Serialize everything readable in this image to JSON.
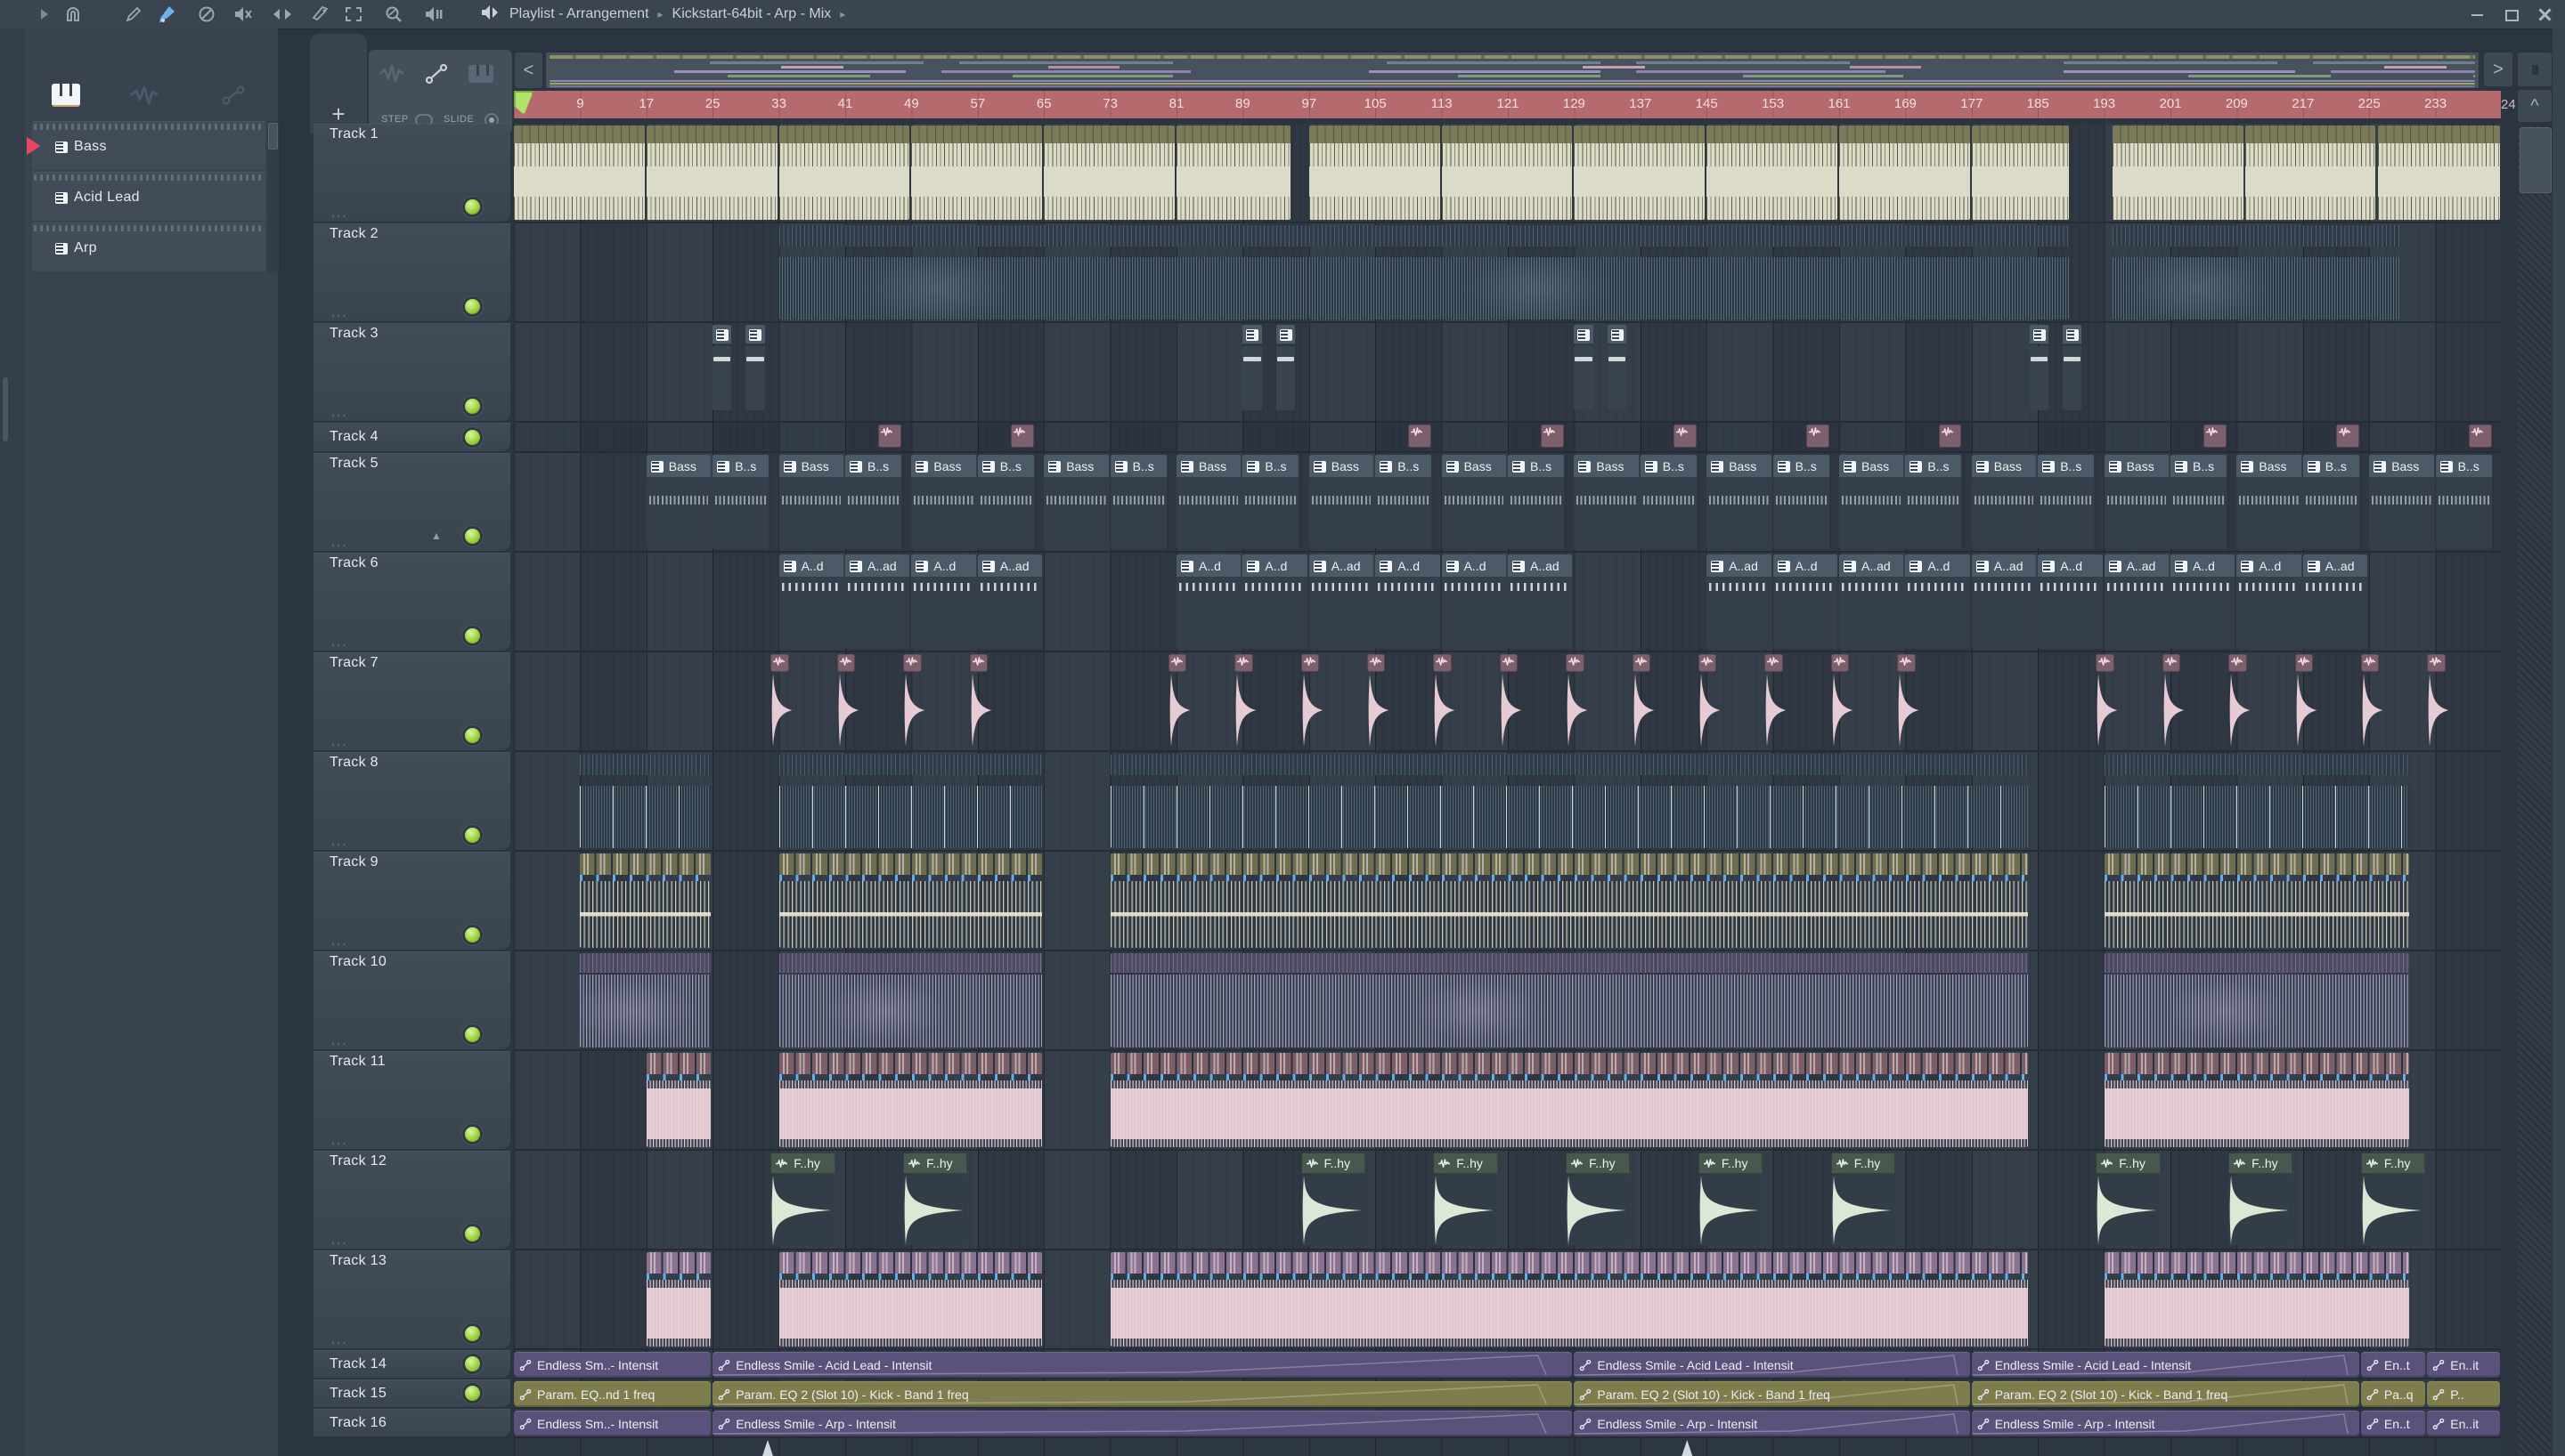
{
  "window": {
    "breadcrumb": [
      "Playlist - Arrangement",
      "Kickstart-64bit - Arp - Mix"
    ],
    "controls": [
      "minimize",
      "maximize",
      "close"
    ]
  },
  "toolbar": {
    "icons": [
      "play-arrow",
      "magnet",
      "pencil",
      "paint-brush",
      "no-entry",
      "mute",
      "slip",
      "slice",
      "select",
      "zoom",
      "preview-speaker"
    ],
    "active_icon": "paint-brush"
  },
  "picker": {
    "tabs": [
      "piano",
      "waveform",
      "automation"
    ],
    "selected_tab": "piano",
    "patterns": [
      {
        "name": "Bass",
        "selected": true
      },
      {
        "name": "Acid Lead",
        "selected": false
      },
      {
        "name": "Arp",
        "selected": false
      }
    ]
  },
  "playlist": {
    "buttons": {
      "add": "+",
      "scroll_left": "<",
      "scroll_right": ">",
      "up": "^"
    },
    "tools": {
      "step_label": "STEP",
      "slide_label": "SLIDE",
      "step_on": false,
      "slide_on": true
    },
    "ruler": {
      "labels": [
        9,
        17,
        25,
        33,
        41,
        49,
        57,
        65,
        73,
        81,
        89,
        97,
        105,
        113,
        121,
        129,
        137,
        145,
        153,
        161,
        169,
        177,
        185,
        193,
        201,
        209,
        217,
        225,
        233
      ],
      "overflow_label": "24",
      "playhead_bar": 1
    },
    "tracks": [
      {
        "name": "Track 1",
        "h": "n",
        "kind": "cream",
        "clips": [
          {
            "s": 1,
            "l": 16
          },
          {
            "s": 17,
            "l": 16
          },
          {
            "s": 33,
            "l": 16
          },
          {
            "s": 49,
            "l": 16
          },
          {
            "s": 65,
            "l": 16
          },
          {
            "s": 81,
            "l": 14
          },
          {
            "s": 97,
            "l": 16
          },
          {
            "s": 113,
            "l": 16
          },
          {
            "s": 129,
            "l": 16
          },
          {
            "s": 145,
            "l": 16
          },
          {
            "s": 161,
            "l": 16
          },
          {
            "s": 177,
            "l": 12
          },
          {
            "s": 194,
            "l": 16
          },
          {
            "s": 210,
            "l": 16
          },
          {
            "s": 226,
            "l": 15
          }
        ]
      },
      {
        "name": "Track 2",
        "h": "n",
        "kind": "teal",
        "clips": [
          {
            "s": 33,
            "l": 64
          },
          {
            "s": 97,
            "l": 92
          },
          {
            "s": 194,
            "l": 35
          }
        ]
      },
      {
        "name": "Track 3",
        "h": "n",
        "kind": "pat3",
        "clips": [
          {
            "s": 25,
            "l": 2.5
          },
          {
            "s": 29,
            "l": 2.5
          },
          {
            "s": 89,
            "l": 2.5
          },
          {
            "s": 93,
            "l": 2.5
          },
          {
            "s": 129,
            "l": 2.5
          },
          {
            "s": 133,
            "l": 2.5
          },
          {
            "s": 184,
            "l": 2.5
          },
          {
            "s": 188,
            "l": 2.5
          }
        ]
      },
      {
        "name": "Track 4",
        "h": "s",
        "kind": "kick",
        "clips": [
          {
            "s": 45,
            "l": 3
          },
          {
            "s": 61,
            "l": 3
          },
          {
            "s": 109,
            "l": 3
          },
          {
            "s": 125,
            "l": 3
          },
          {
            "s": 141,
            "l": 3
          },
          {
            "s": 157,
            "l": 3
          },
          {
            "s": 173,
            "l": 3
          },
          {
            "s": 205,
            "l": 3
          },
          {
            "s": 221,
            "l": 3
          },
          {
            "s": 237,
            "l": 3
          }
        ]
      },
      {
        "name": "Track 5",
        "h": "n",
        "kind": "patB",
        "collapse": true,
        "clips": [
          {
            "s": 17,
            "l": 8,
            "t": "Bass"
          },
          {
            "s": 25,
            "l": 7,
            "t": "B..s"
          },
          {
            "s": 33,
            "l": 8,
            "t": "Bass"
          },
          {
            "s": 41,
            "l": 7,
            "t": "B..s"
          },
          {
            "s": 49,
            "l": 8,
            "t": "Bass"
          },
          {
            "s": 57,
            "l": 7,
            "t": "B..s"
          },
          {
            "s": 65,
            "l": 8,
            "t": "Bass"
          },
          {
            "s": 73,
            "l": 7,
            "t": "B..s"
          },
          {
            "s": 81,
            "l": 8,
            "t": "Bass"
          },
          {
            "s": 89,
            "l": 7,
            "t": "B..s"
          },
          {
            "s": 97,
            "l": 8,
            "t": "Bass"
          },
          {
            "s": 105,
            "l": 7,
            "t": "B..s"
          },
          {
            "s": 113,
            "l": 8,
            "t": "Bass"
          },
          {
            "s": 121,
            "l": 7,
            "t": "B..s"
          },
          {
            "s": 129,
            "l": 8,
            "t": "Bass"
          },
          {
            "s": 137,
            "l": 7,
            "t": "B..s"
          },
          {
            "s": 145,
            "l": 8,
            "t": "Bass"
          },
          {
            "s": 153,
            "l": 7,
            "t": "B..s"
          },
          {
            "s": 161,
            "l": 8,
            "t": "Bass"
          },
          {
            "s": 169,
            "l": 7,
            "t": "B..s"
          },
          {
            "s": 177,
            "l": 8,
            "t": "Bass"
          },
          {
            "s": 185,
            "l": 7,
            "t": "B..s"
          },
          {
            "s": 193,
            "l": 8,
            "t": "Bass"
          },
          {
            "s": 201,
            "l": 7,
            "t": "B..s"
          },
          {
            "s": 209,
            "l": 8,
            "t": "Bass"
          },
          {
            "s": 217,
            "l": 7,
            "t": "B..s"
          },
          {
            "s": 225,
            "l": 8,
            "t": "Bass"
          },
          {
            "s": 233,
            "l": 7,
            "t": "B..s"
          }
        ]
      },
      {
        "name": "Track 6",
        "h": "n",
        "kind": "patA",
        "clips": [
          {
            "s": 33,
            "l": 8,
            "t": "A..d"
          },
          {
            "s": 41,
            "l": 8,
            "t": "A..ad"
          },
          {
            "s": 49,
            "l": 8,
            "t": "A..d"
          },
          {
            "s": 57,
            "l": 8,
            "t": "A..ad"
          },
          {
            "s": 81,
            "l": 8,
            "t": "A..d"
          },
          {
            "s": 89,
            "l": 8,
            "t": "A..d"
          },
          {
            "s": 97,
            "l": 8,
            "t": "A..ad"
          },
          {
            "s": 105,
            "l": 8,
            "t": "A..d"
          },
          {
            "s": 113,
            "l": 8,
            "t": "A..d"
          },
          {
            "s": 121,
            "l": 8,
            "t": "A..ad"
          },
          {
            "s": 145,
            "l": 8,
            "t": "A..ad"
          },
          {
            "s": 153,
            "l": 8,
            "t": "A..d"
          },
          {
            "s": 161,
            "l": 8,
            "t": "A..ad"
          },
          {
            "s": 169,
            "l": 8,
            "t": "A..d"
          },
          {
            "s": 177,
            "l": 8,
            "t": "A..ad"
          },
          {
            "s": 185,
            "l": 8,
            "t": "A..d"
          },
          {
            "s": 193,
            "l": 8,
            "t": "A..ad"
          },
          {
            "s": 201,
            "l": 8,
            "t": "A..d"
          },
          {
            "s": 209,
            "l": 8,
            "t": "A..d"
          },
          {
            "s": 217,
            "l": 8,
            "t": "A..ad"
          }
        ]
      },
      {
        "name": "Track 7",
        "h": "n",
        "kind": "kdecay",
        "clips": [
          {
            "s": 32,
            "l": 3
          },
          {
            "s": 40,
            "l": 3
          },
          {
            "s": 48,
            "l": 3
          },
          {
            "s": 56,
            "l": 3
          },
          {
            "s": 80,
            "l": 3
          },
          {
            "s": 88,
            "l": 3
          },
          {
            "s": 96,
            "l": 3
          },
          {
            "s": 104,
            "l": 3
          },
          {
            "s": 112,
            "l": 3
          },
          {
            "s": 120,
            "l": 3
          },
          {
            "s": 128,
            "l": 3
          },
          {
            "s": 136,
            "l": 3
          },
          {
            "s": 144,
            "l": 3
          },
          {
            "s": 152,
            "l": 3
          },
          {
            "s": 160,
            "l": 3
          },
          {
            "s": 168,
            "l": 3
          },
          {
            "s": 192,
            "l": 3
          },
          {
            "s": 200,
            "l": 3
          },
          {
            "s": 208,
            "l": 3
          },
          {
            "s": 216,
            "l": 3
          },
          {
            "s": 224,
            "l": 3
          },
          {
            "s": 232,
            "l": 3
          }
        ]
      },
      {
        "name": "Track 8",
        "h": "n",
        "kind": "teal2",
        "clips": [
          {
            "s": 9,
            "l": 16
          },
          {
            "s": 33,
            "l": 32
          },
          {
            "s": 73,
            "l": 111
          },
          {
            "s": 193,
            "l": 37
          }
        ]
      },
      {
        "name": "Track 9",
        "h": "n",
        "kind": "oheads",
        "clips": [
          {
            "s": 9,
            "l": 16
          },
          {
            "s": 33,
            "l": 32
          },
          {
            "s": 73,
            "l": 111
          },
          {
            "s": 193,
            "l": 37
          }
        ]
      },
      {
        "name": "Track 10",
        "h": "n",
        "kind": "pwave",
        "clips": [
          {
            "s": 9,
            "l": 16
          },
          {
            "s": 33,
            "l": 32
          },
          {
            "s": 73,
            "l": 111
          },
          {
            "s": 193,
            "l": 37
          }
        ]
      },
      {
        "name": "Track 11",
        "h": "n",
        "kind": "mheads",
        "clips": [
          {
            "s": 17,
            "l": 8
          },
          {
            "s": 33,
            "l": 32
          },
          {
            "s": 73,
            "l": 111
          },
          {
            "s": 193,
            "l": 37
          }
        ]
      },
      {
        "name": "Track 12",
        "h": "n",
        "kind": "fhy",
        "clips": [
          {
            "s": 32,
            "l": 8,
            "t": "F..hy"
          },
          {
            "s": 48,
            "l": 8,
            "t": "F..hy"
          },
          {
            "s": 96,
            "l": 8,
            "t": "F..hy"
          },
          {
            "s": 112,
            "l": 8,
            "t": "F..hy"
          },
          {
            "s": 128,
            "l": 8,
            "t": "F..hy"
          },
          {
            "s": 144,
            "l": 8,
            "t": "F..hy"
          },
          {
            "s": 160,
            "l": 8,
            "t": "F..hy"
          },
          {
            "s": 192,
            "l": 8,
            "t": "F..hy"
          },
          {
            "s": 208,
            "l": 8,
            "t": "F..hy"
          },
          {
            "s": 224,
            "l": 8,
            "t": "F..hy"
          }
        ]
      },
      {
        "name": "Track 13",
        "h": "n",
        "kind": "lheads",
        "clips": [
          {
            "s": 17,
            "l": 8
          },
          {
            "s": 33,
            "l": 32
          },
          {
            "s": 73,
            "l": 111
          },
          {
            "s": 193,
            "l": 37
          }
        ]
      },
      {
        "name": "Track 14",
        "h": "a",
        "kind": "auto",
        "color": "purple",
        "clips": [
          {
            "s": 1,
            "l": 24,
            "t": "Endless Sm..- Intensit"
          },
          {
            "s": 25,
            "l": 104,
            "t": "Endless Smile - Acid Lead - Intensit"
          },
          {
            "s": 129,
            "l": 48,
            "t": "Endless Smile - Acid Lead - Intensit"
          },
          {
            "s": 177,
            "l": 47,
            "t": "Endless Smile - Acid Lead - Intensit"
          },
          {
            "s": 224,
            "l": 8,
            "t": "En..t"
          },
          {
            "s": 232,
            "l": 9,
            "t": "En..it"
          }
        ]
      },
      {
        "name": "Track 15",
        "h": "a",
        "kind": "auto",
        "color": "olive",
        "clips": [
          {
            "s": 1,
            "l": 24,
            "t": "Param. EQ..nd 1 freq"
          },
          {
            "s": 25,
            "l": 104,
            "t": "Param. EQ 2 (Slot 10) - Kick - Band 1 freq"
          },
          {
            "s": 129,
            "l": 48,
            "t": "Param. EQ 2 (Slot 10) - Kick - Band 1 freq"
          },
          {
            "s": 177,
            "l": 47,
            "t": "Param. EQ 2 (Slot 10) - Kick - Band 1 freq"
          },
          {
            "s": 224,
            "l": 8,
            "t": "Pa..q"
          },
          {
            "s": 232,
            "l": 9,
            "t": "P.."
          }
        ]
      },
      {
        "name": "Track 16",
        "h": "a",
        "kind": "auto",
        "color": "purple",
        "led": false,
        "clips": [
          {
            "s": 1,
            "l": 24,
            "t": "Endless Sm..- Intensit"
          },
          {
            "s": 25,
            "l": 104,
            "t": "Endless Smile - Arp - Intensit"
          },
          {
            "s": 129,
            "l": 48,
            "t": "Endless Smile - Arp - Intensit"
          },
          {
            "s": 177,
            "l": 47,
            "t": "Endless Smile - Arp - Intensit"
          },
          {
            "s": 224,
            "l": 8,
            "t": "En..t"
          },
          {
            "s": 232,
            "l": 9,
            "t": "En..it"
          }
        ]
      }
    ],
    "bottom_spikes_bars": [
      31,
      142
    ]
  },
  "colors": {
    "accent_brush": "#6CB2E8",
    "ruler": "#B56A6E",
    "led": "#A8D94E",
    "cream": "#DBDBC7",
    "olive_header": "#7B7A58",
    "pattern_title": "#4C5966",
    "mauve": "#7E5F6E",
    "pink_wave": "#E9D0D8",
    "olive_cells": "#6F6D50",
    "purple_wave": "#B7B1D4",
    "light_purple": "#8C7291",
    "sage": "#49584E",
    "slice_marker_blue": "#5FB0EE",
    "automation_purple": "#5B527B",
    "automation_olive": "#7E7E4C",
    "pattern_marker_red": "#E8475F",
    "playhead_green": "#AFE26A"
  }
}
